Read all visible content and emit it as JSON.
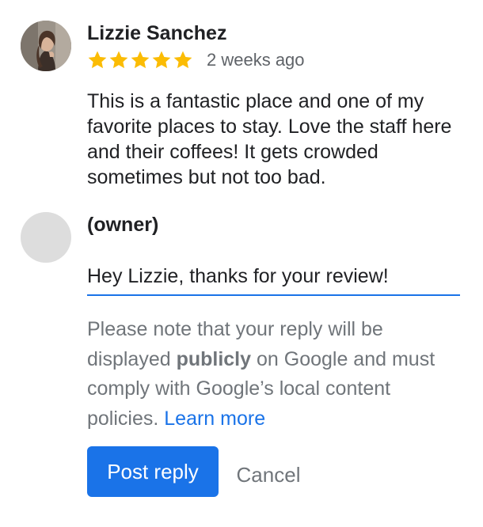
{
  "review": {
    "author": "Lizzie Sanchez",
    "rating": 5,
    "max_rating": 5,
    "time_ago": "2 weeks ago",
    "text": "This is a fantastic place and one of my favorite places to stay. Love the staff here and their coffees! It gets crowded sometimes but not too bad."
  },
  "reply": {
    "owner_label": "(owner)",
    "input_value": "Hey Lizzie, thanks for your review!",
    "notice_before": "Please note that your reply will be displayed ",
    "notice_bold": "publicly",
    "notice_after": " on Google and must comply with Google’s local content policies. ",
    "learn_more": "Learn more",
    "post_label": "Post reply",
    "cancel_label": "Cancel"
  },
  "colors": {
    "accent": "#1a73e8",
    "star": "#fbbc04",
    "muted_text": "#70757a",
    "owner_avatar_placeholder": "#dddddd"
  },
  "icons": {
    "star": "star-icon"
  }
}
